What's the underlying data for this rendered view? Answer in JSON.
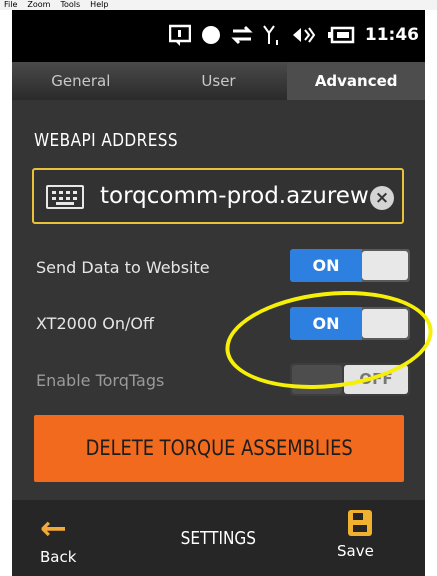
{
  "menubar": {
    "items": [
      "File",
      "Zoom",
      "Tools",
      "Help"
    ]
  },
  "statusbar": {
    "time": "11:46",
    "icons": [
      "notification-icon",
      "record-icon",
      "data-transfer-icon",
      "signal-icon",
      "volume-icon",
      "battery-icon"
    ]
  },
  "tabs": [
    {
      "label": "General",
      "active": false
    },
    {
      "label": "User",
      "active": false
    },
    {
      "label": "Advanced",
      "active": true
    }
  ],
  "webapi": {
    "title": "WEBAPI ADDRESS",
    "value": "torqcomm-prod.azurew"
  },
  "settings": [
    {
      "label": "Send Data to Website",
      "state": "ON"
    },
    {
      "label": "XT2000 On/Off",
      "state": "ON"
    },
    {
      "label": "Enable TorqTags",
      "state": "OFF"
    }
  ],
  "delete_button": "DELETE TORQUE ASSEMBLIES",
  "bottom": {
    "back_label": "Back",
    "title": "SETTINGS",
    "save_label": "Save"
  },
  "colors": {
    "accent_orange": "#f26a1e",
    "toggle_on": "#2d7fe0",
    "field_border": "#e8c33a",
    "annotation": "#f5ef0a"
  }
}
